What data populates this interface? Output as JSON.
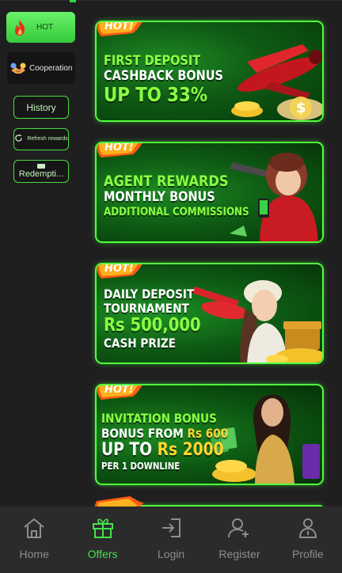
{
  "sidebar": {
    "categories": [
      {
        "label": "HOT",
        "icon": "flame-icon",
        "active": true
      },
      {
        "label": "Cooperation",
        "icon": "handshake-icon",
        "active": false
      }
    ],
    "history_label": "History",
    "refresh_label": "Refresh rewards",
    "redemption_label": "Redempti..."
  },
  "hot_badge": "HOT!",
  "banners": [
    {
      "lines": [
        "FIRST DEPOSIT",
        "CASHBACK BONUS",
        "UP TO 33%"
      ]
    },
    {
      "lines": [
        "AGENT REWARDS",
        "MONTHLY BONUS",
        "ADDITIONAL COMMISSIONS"
      ]
    },
    {
      "lines": [
        "DAILY DEPOSIT",
        "TOURNAMENT",
        "Rs 500,000",
        "CASH PRIZE"
      ]
    },
    {
      "lines": [
        "INVITATION BONUS",
        "BONUS FROM",
        "Rs 600",
        "UP TO",
        "Rs 2000",
        "PER 1 DOWNLINE"
      ]
    }
  ],
  "bottom_nav": [
    {
      "label": "Home",
      "icon": "home-icon",
      "active": false
    },
    {
      "label": "Offers",
      "icon": "gift-icon",
      "active": true
    },
    {
      "label": "Login",
      "icon": "login-icon",
      "active": false
    },
    {
      "label": "Register",
      "icon": "add-user-icon",
      "active": false
    },
    {
      "label": "Profile",
      "icon": "profile-icon",
      "active": false
    }
  ],
  "colors": {
    "accent": "#43e34a",
    "banner_border": "#52ff3e",
    "background": "#1f1f1f",
    "nav_bg": "#2b2b2b"
  }
}
